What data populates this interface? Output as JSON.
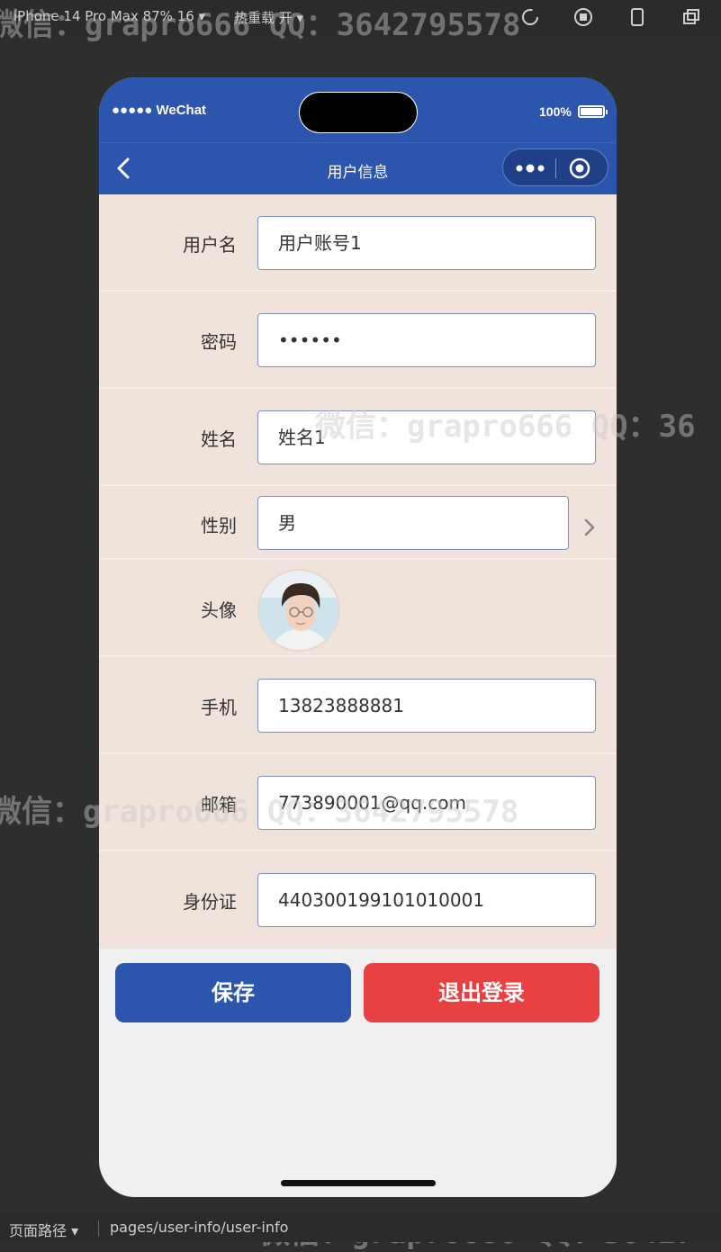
{
  "devtools": {
    "device": "iPhone 14 Pro Max 87% 16 ▾",
    "hot_reload": "热重载 开 ▾",
    "path_label": "页面路径 ▾",
    "path": "pages/user-info/user-info"
  },
  "status_bar": {
    "carrier": "●●●●● WeChat",
    "battery": "100%"
  },
  "nav": {
    "title": "用户信息"
  },
  "form": {
    "username": {
      "label": "用户名",
      "value": "用户账号1"
    },
    "password": {
      "label": "密码",
      "value": "••••••"
    },
    "name": {
      "label": "姓名",
      "value": "姓名1"
    },
    "gender": {
      "label": "性别",
      "value": "男"
    },
    "avatar": {
      "label": "头像"
    },
    "phone": {
      "label": "手机",
      "value": "13823888881"
    },
    "email": {
      "label": "邮箱",
      "value": "773890001@qq.com"
    },
    "id_card": {
      "label": "身份证",
      "value": "440300199101010001"
    }
  },
  "buttons": {
    "save": "保存",
    "logout": "退出登录"
  },
  "watermarks": {
    "top": "微信：grapro666 QQ：3642795578",
    "middle": "微信：grapro666 QQ：36",
    "lower": "微信：grapro666 QQ：3642795578",
    "bottom": "微信：grapro666 QQ：36427"
  },
  "colors": {
    "primary": "#2c55ad",
    "danger": "#e94141",
    "form_bg": "#f0e3db"
  }
}
